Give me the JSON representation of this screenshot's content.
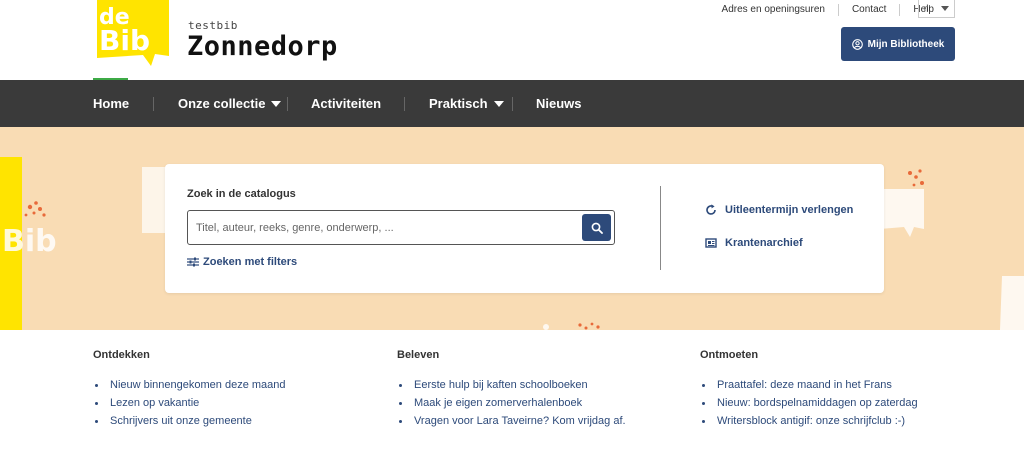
{
  "brand": {
    "logo_text_top": "de",
    "logo_text_bottom": "Bib",
    "small": "testbib",
    "name": "Zonnedorp"
  },
  "toplinks": [
    "Adres en openingsuren",
    "Contact",
    "Help"
  ],
  "language": "nl",
  "mijn_button": "Mijn Bibliotheek",
  "nav": [
    {
      "label": "Home",
      "dropdown": false
    },
    {
      "label": "Onze collectie",
      "dropdown": true
    },
    {
      "label": "Activiteiten",
      "dropdown": false
    },
    {
      "label": "Praktisch",
      "dropdown": true
    },
    {
      "label": "Nieuws",
      "dropdown": false
    }
  ],
  "search": {
    "label": "Zoek in de catalogus",
    "placeholder": "Titel, auteur, reeks, genre, onderwerp, ...",
    "filters_link": "Zoeken met filters"
  },
  "side_links": {
    "renew": "Uitleentermijn verlengen",
    "archive": "Krantenarchief"
  },
  "columns": [
    {
      "title": "Ontdekken",
      "items": [
        "Nieuw binnengekomen deze maand",
        "Lezen op vakantie",
        "Schrijvers uit onze gemeente"
      ]
    },
    {
      "title": "Beleven",
      "items": [
        "Eerste hulp bij kaften schoolboeken",
        "Maak je eigen zomerverhalenboek",
        "Vragen voor Lara Taveirne? Kom vrijdag af."
      ]
    },
    {
      "title": "Ontmoeten",
      "items": [
        "Praattafel: deze maand in het Frans",
        "Nieuw: bordspelnamiddagen op zaterdag",
        "Writersblock antigif: onze schrijfclub :-)"
      ]
    }
  ],
  "colors": {
    "accent": "#2d4a7a",
    "logo_yellow": "#ffe400",
    "nav_bg": "#3a3a3a",
    "hero_bg": "#f9dcb4"
  }
}
